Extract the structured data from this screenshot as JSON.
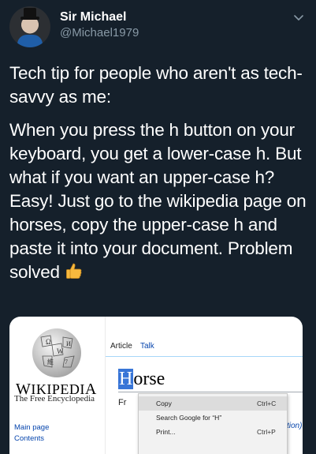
{
  "author": {
    "display_name": "Sir Michael",
    "handle": "@Michael1979"
  },
  "tweet": {
    "intro": "Tech tip for people who aren't as tech-savvy as me:",
    "body": "When you press the h button on your keyboard, you get a lower-case h. But what if you want an upper-case h? Easy! Just go to the wikipedia page on horses, copy the upper-case h and paste it into your document. Problem solved",
    "emoji": "thumbs-up-icon"
  },
  "screenshot": {
    "wordmark_first": "W",
    "wordmark_rest": "IKIPEDI",
    "wordmark_last": "A",
    "tagline": "The Free Encyclopedia",
    "side_links": [
      "Main page",
      "Contents"
    ],
    "tabs": [
      "Article",
      "Talk"
    ],
    "title_selected": "H",
    "title_rest": "orse",
    "fragment_left": "Fr",
    "fragment_right": "tion).",
    "context_menu": [
      {
        "label": "Copy",
        "shortcut": "Ctrl+C"
      },
      {
        "label": "Search Google for “H”",
        "shortcut": ""
      },
      {
        "label": "Print...",
        "shortcut": "Ctrl+P"
      }
    ]
  },
  "colors": {
    "background": "#15202b",
    "handle": "#8899a6",
    "selection": "#3875d7",
    "link": "#0645ad"
  }
}
